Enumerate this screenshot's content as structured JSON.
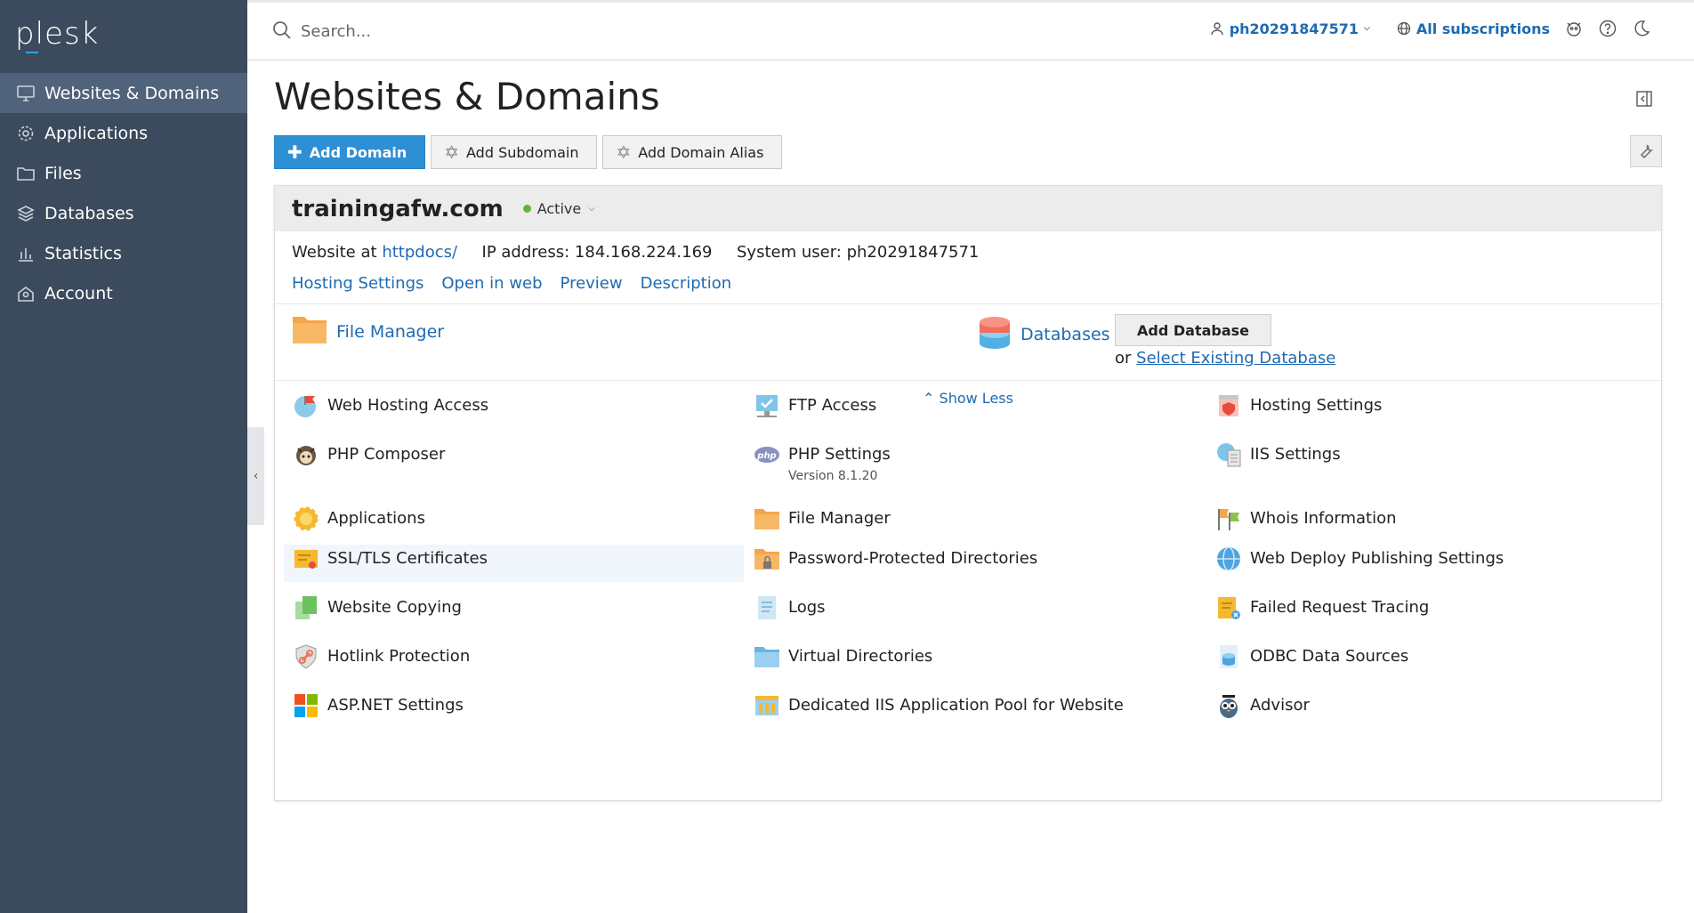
{
  "sidebar": {
    "logo": "plesk",
    "items": [
      {
        "label": "Websites & Domains",
        "icon": "monitor-icon"
      },
      {
        "label": "Applications",
        "icon": "gear-icon"
      },
      {
        "label": "Files",
        "icon": "folder-icon"
      },
      {
        "label": "Databases",
        "icon": "stack-icon"
      },
      {
        "label": "Statistics",
        "icon": "bar-chart-icon"
      },
      {
        "label": "Account",
        "icon": "account-icon"
      }
    ]
  },
  "topbar": {
    "search_placeholder": "Search...",
    "user": "ph20291847571",
    "subscriptions": "All subscriptions"
  },
  "page": {
    "title": "Websites & Domains",
    "buttons": {
      "add_domain": "Add Domain",
      "add_subdomain": "Add Subdomain",
      "add_alias": "Add Domain Alias"
    }
  },
  "domain": {
    "name": "trainingafw.com",
    "status": "Active",
    "website_at_label": "Website at",
    "docroot": "httpdocs/",
    "ip_label": "IP address:",
    "ip": "184.168.224.169",
    "sysuser_label": "System user:",
    "sysuser": "ph20291847571",
    "links": [
      "Hosting Settings",
      "Open in web",
      "Preview",
      "Description"
    ],
    "file_manager": "File Manager",
    "databases": "Databases",
    "add_database": "Add Database",
    "or": "or",
    "select_existing": "Select Existing Database",
    "show_less": "Show Less"
  },
  "tools": [
    {
      "label": "Web Hosting Access",
      "icon": "globe-flag-icon"
    },
    {
      "label": "FTP Access",
      "icon": "ftp-icon"
    },
    {
      "label": "Hosting Settings",
      "icon": "hosting-settings-icon"
    },
    {
      "label": "PHP Composer",
      "icon": "composer-icon"
    },
    {
      "label": "PHP Settings",
      "sub": "Version 8.1.20",
      "icon": "php-icon"
    },
    {
      "label": "IIS Settings",
      "icon": "iis-icon"
    },
    {
      "label": "Applications",
      "icon": "sun-gear-icon"
    },
    {
      "label": "File Manager",
      "icon": "folder-icon"
    },
    {
      "label": "Whois Information",
      "icon": "flags-icon"
    },
    {
      "label": "SSL/TLS Certificates",
      "icon": "certificate-icon"
    },
    {
      "label": "Password-Protected Directories",
      "icon": "locked-folder-icon"
    },
    {
      "label": "Web Deploy Publishing Settings",
      "icon": "web-deploy-icon"
    },
    {
      "label": "Website Copying",
      "icon": "copy-icon"
    },
    {
      "label": "Logs",
      "icon": "logs-icon"
    },
    {
      "label": "Failed Request Tracing",
      "icon": "tracing-icon"
    },
    {
      "label": "Hotlink Protection",
      "icon": "shield-link-icon"
    },
    {
      "label": "Virtual Directories",
      "icon": "virtual-folder-icon"
    },
    {
      "label": "ODBC Data Sources",
      "icon": "odbc-icon"
    },
    {
      "label": "ASP.NET Settings",
      "icon": "aspnet-icon"
    },
    {
      "label": "Dedicated IIS Application Pool for Website",
      "icon": "app-pool-icon"
    },
    {
      "label": "Advisor",
      "icon": "owl-icon"
    }
  ],
  "colors": {
    "sidebar_bg": "#3b4a5c",
    "sidebar_active": "#51637a",
    "link": "#1f6ab1",
    "primary_button": "#2f8fd5",
    "active_status": "#64b43c"
  }
}
